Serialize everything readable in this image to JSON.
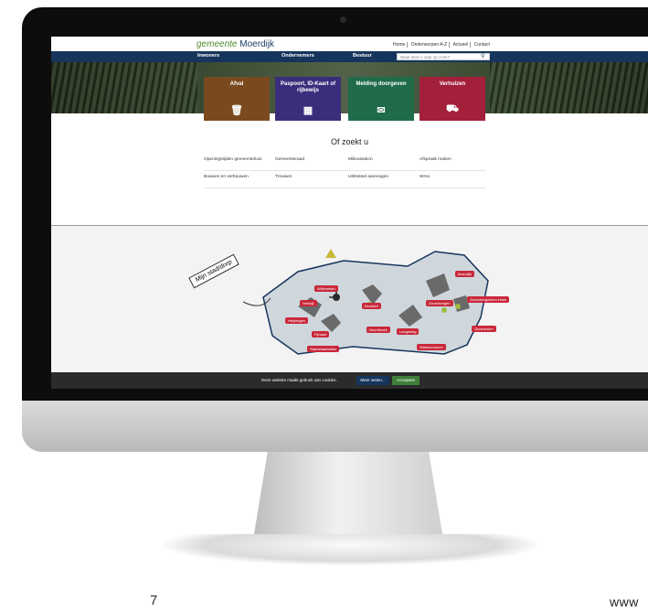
{
  "site": {
    "logo_prefix": "gemeente",
    "logo_name": "Moerdijk",
    "utility_links": [
      "Home",
      "Onderwerpen A-Z",
      "Actueel",
      "Contact"
    ],
    "nav": [
      "Inwoners",
      "Ondernemers",
      "Bestuur"
    ],
    "search_placeholder": "Waar bent u naar op zoek?",
    "tiles": [
      {
        "label": "Afval",
        "icon": "trash-icon",
        "color": "#7a4a1e"
      },
      {
        "label": "Paspoort, ID-Kaart of rijbewijs",
        "icon": "id-card-icon",
        "color": "#3a2e7c"
      },
      {
        "label": "Melding doorgeven",
        "icon": "message-icon",
        "color": "#1f6b4a"
      },
      {
        "label": "Verhuizen",
        "icon": "truck-icon",
        "color": "#a3203a"
      }
    ],
    "search_title": "Of zoekt u",
    "quick_links": [
      "Openingstijden gemeentehuis",
      "Gemeenteraad",
      "Milieustation",
      "Afspraak maken",
      "Bouwen en verbouwen",
      "Trouwen",
      "Uittreksel aanvragen",
      "Wmo"
    ],
    "map_label": "Mijn stad/dorp",
    "towns": [
      "Willemstad",
      "Helwijk",
      "Klundert",
      "Fijnaart",
      "Heijningen",
      "Standdaarbuiten",
      "Noordhoek",
      "Zevenbergen",
      "Langeweg",
      "Moerdijk",
      "Zevenbergschen Hoek",
      "Oudemolen",
      "Stadsmuseum"
    ],
    "cookie_text": "Deze website maakt gebruik van cookies.",
    "cookie_more": "Meer weten...",
    "cookie_accept": "Accepteer"
  },
  "page": {
    "number": "7",
    "footer": "www"
  }
}
